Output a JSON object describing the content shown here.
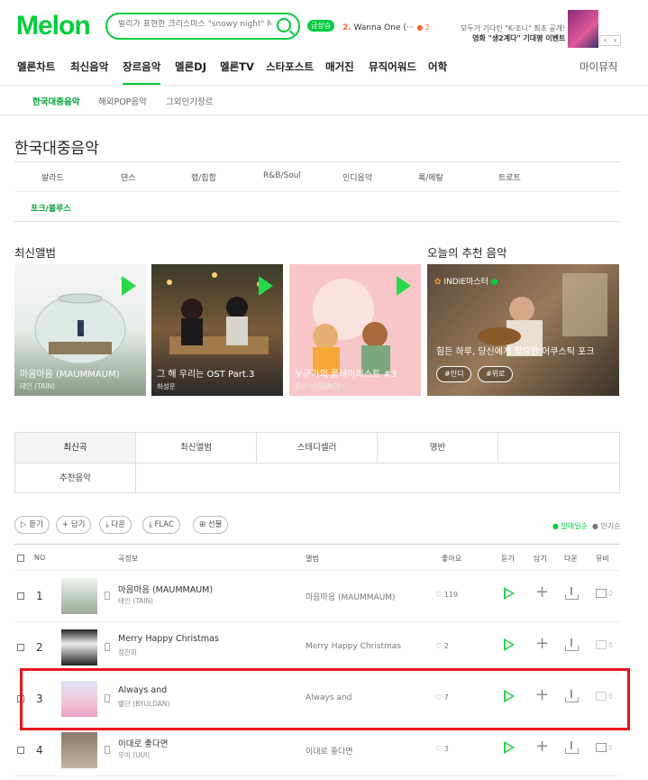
{
  "header": {
    "logo": "Melon",
    "search_placeholder": "빌리가 표현한 크리스마스 \"snowy night\" MV",
    "rise_badge": "급상승",
    "rank_num": "2.",
    "rank_text": "Wanna One (···",
    "rank_change": "● 2",
    "promo_line1": "모두가 기다린 \"K-조니\" 최초 공개!",
    "promo_line2": "영화 \"생2계다\" 기대평 이벤트",
    "promo_prev": "‹",
    "promo_next": "›"
  },
  "gnb": [
    "멜론차트",
    "최신음악",
    "장르음악",
    "멜론DJ",
    "멜론TV",
    "스타포스트",
    "매거진",
    "뮤직어워드",
    "어학"
  ],
  "gnb_right": "마이뮤직",
  "subnav": [
    "한국대중음악",
    "해외POP음악",
    "그외인기장르"
  ],
  "page_title": "한국대중음악",
  "genres": [
    "발라드",
    "댄스",
    "랩/힙합",
    "R&B/Soul",
    "인디음악",
    "록/메탈",
    "트로트",
    "포크/블루스"
  ],
  "new_albums_title": "최신앨범",
  "recommend_title": "오늘의 추천 음악",
  "albums": [
    {
      "title": "마음마음 (MAUMMAUM)",
      "artist": "태인 (TAIN)"
    },
    {
      "title": "그 해 우리는 OST Part.3",
      "artist": "하성운"
    },
    {
      "title": "누군가의 플레이리스트 #3",
      "artist": "훈스 (HOONS)"
    }
  ],
  "recommend": {
    "badge": "INDIE마스터",
    "caption": "힘든 하루, 당신에게 필요한 어쿠스틱 포크",
    "tags": [
      "#인디",
      "#위로"
    ]
  },
  "tabs": [
    "최신곡",
    "최신앨범",
    "스테디셀러",
    "명반",
    "추천음악"
  ],
  "tools": [
    "듣기",
    "+ 담기",
    "다운",
    "FLAC",
    "선물"
  ],
  "sort": {
    "active": "● 발매일순",
    "other": "● 인기순"
  },
  "table_headers": {
    "no": "NO",
    "song": "곡정보",
    "album": "앨범",
    "like": "좋아요",
    "listen": "듣기",
    "add": "담기",
    "download": "다운",
    "mv": "뮤비"
  },
  "rows": [
    {
      "no": "1",
      "song": "마음마음 (MAUMMAUM)",
      "artist": "태인 (TAIN)",
      "album": "마음마음 (MAUMMAUM)",
      "likes": "119",
      "mv": "0"
    },
    {
      "no": "2",
      "song": "Merry Happy Christmas",
      "artist": "정진희",
      "album": "Merry Happy Christmas",
      "likes": "2",
      "mv": "0"
    },
    {
      "no": "3",
      "song": "Always and",
      "artist": "별단 (BYULDAN)",
      "album": "Always and",
      "likes": "7",
      "mv": "0"
    },
    {
      "no": "4",
      "song": "이대로 좋다면",
      "artist": "우이 (UUI)",
      "album": "이대로 좋다면",
      "likes": "3",
      "mv": "0"
    }
  ],
  "colors": {
    "brand": "#00cd3c",
    "highlight": "#e8161e"
  }
}
